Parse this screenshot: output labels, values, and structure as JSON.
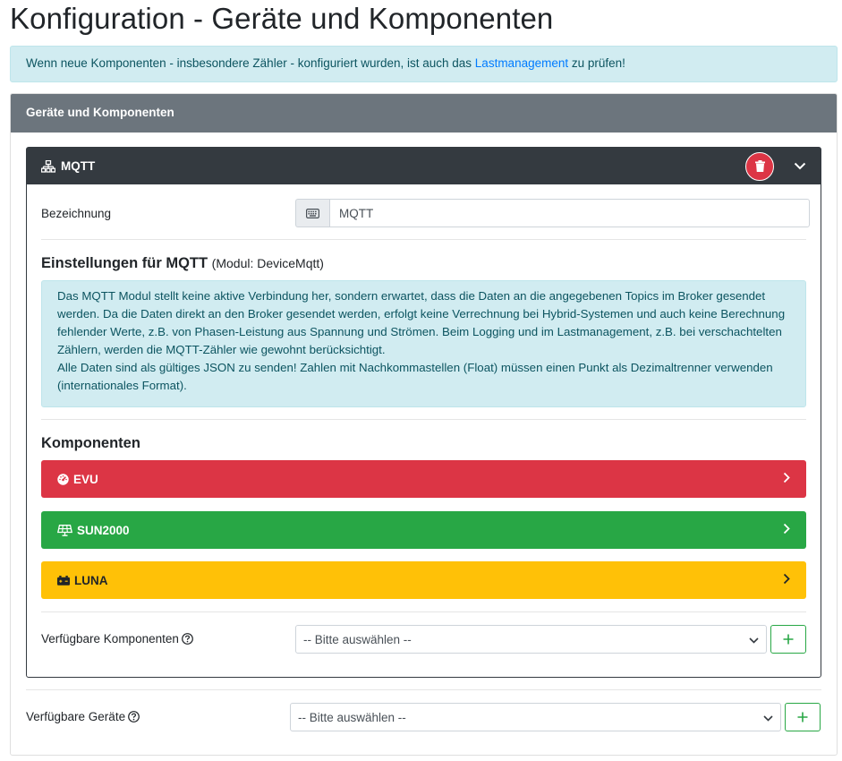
{
  "page": {
    "title": "Konfiguration - Geräte und Komponenten"
  },
  "notice": {
    "text_before": "Wenn neue Komponenten - insbesondere Zähler - konfiguriert wurden, ist auch das ",
    "link_text": "Lastmanagement",
    "text_after": " zu prüfen!"
  },
  "card": {
    "header": "Geräte und Komponenten"
  },
  "device": {
    "name": "MQTT",
    "icon": "network-icon",
    "delete_icon": "trash-icon",
    "collapse_icon": "chevron-down-icon",
    "label_field": "Bezeichnung",
    "name_value": "MQTT",
    "keyboard_icon": "keyboard-icon",
    "settings_title": "Einstellungen für MQTT",
    "settings_module": "(Modul: DeviceMqtt)",
    "info_p1": "Das MQTT Modul stellt keine aktive Verbindung her, sondern erwartet, dass die Daten an die angegebenen Topics im Broker gesendet werden. Da die Daten direkt an den Broker gesendet werden, erfolgt keine Verrechnung bei Hybrid-Systemen und auch keine Berechnung fehlender Werte, z.B. von Phasen-Leistung aus Spannung und Strömen. Beim Logging und im Lastmanagement, z.B. bei verschachtelten Zählern, werden die MQTT-Zähler wie gewohnt berücksichtigt.",
    "info_p2": "Alle Daten sind als gültiges JSON zu senden! Zahlen mit Nachkommastellen (Float) müssen einen Punkt als Dezimaltrenner verwenden (internationales Format).",
    "components_title": "Komponenten",
    "components": [
      {
        "name": "EVU",
        "icon": "gauge-icon",
        "color": "#dc3545"
      },
      {
        "name": "SUN2000",
        "icon": "solar-panel-icon",
        "color": "#28a745"
      },
      {
        "name": "LUNA",
        "icon": "battery-icon",
        "color": "#ffc107"
      }
    ],
    "available_components_label": "Verfügbare Komponenten",
    "available_components_select": "-- Bitte auswählen --"
  },
  "available_devices": {
    "label": "Verfügbare Geräte",
    "select": "-- Bitte auswählen --"
  },
  "colors": {
    "danger": "#dc3545",
    "success": "#28a745",
    "warning": "#ffc107",
    "dark": "#343a40",
    "secondary": "#6c757d",
    "info_bg": "#d1ecf1",
    "link": "#007bff"
  }
}
